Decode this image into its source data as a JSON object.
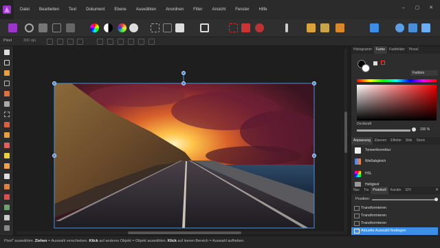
{
  "menu": [
    "Datei",
    "Bearbeiten",
    "Text",
    "Dokument",
    "Ebene",
    "Auswählen",
    "Anordnen",
    "Filter",
    "Ansicht",
    "Fenster",
    "Hilfe"
  ],
  "context": {
    "unit": "Pixel",
    "dpi": "300 dpi"
  },
  "panels": {
    "color_tabs": [
      "Histogramm",
      "Farbe",
      "Farbfelder",
      "Pinsel"
    ],
    "color_mode": "Farbton",
    "opacity_label": "Deckkraft",
    "opacity_value": "100 %",
    "adjust_tabs": [
      "Anpassung",
      "Ebenen",
      "Effekte",
      "Stile",
      "Stock"
    ],
    "adjustments": [
      "Tonwertkorrektur",
      "Weißabgleich",
      "HSL",
      "Helligkeit"
    ],
    "history_tabs": [
      "Nav",
      "Tra",
      "Protokoll",
      "Kanäle",
      "32V"
    ],
    "position_label": "Position:",
    "history": [
      "Transformieren",
      "Transformieren",
      "Transformieren",
      "Aktuelle Auswahl festlegen"
    ]
  },
  "status": {
    "m1": "Pixel\" auswählen.",
    "b1": "Ziehen",
    "m2": "= Auswahl verschieben.",
    "b2": "Klick",
    "m3": "auf anderes Objekt = Objekt auswählen.",
    "b3": "Klick",
    "m4": "auf leeren Bereich = Auswahl aufheben."
  },
  "colors": {
    "accent": "#3d8ee6",
    "selection": "#4a90d9",
    "bg": "#1e1e1e"
  }
}
